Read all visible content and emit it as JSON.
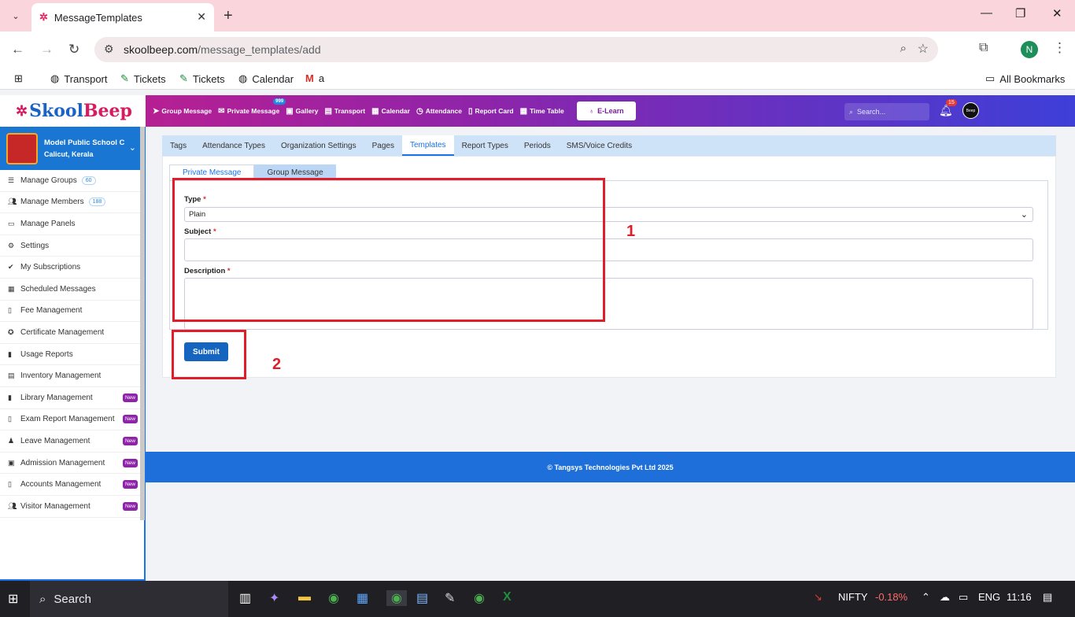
{
  "browser": {
    "tab_title": "MessageTemplates",
    "url_host": "skoolbeep.com",
    "url_path": "/message_templates/add",
    "profile_initial": "N",
    "bookmarks": [
      "Transport",
      "Tickets",
      "Tickets",
      "Calendar",
      "a"
    ],
    "all_bookmarks": "All Bookmarks"
  },
  "app": {
    "logo_prefix": "Skool",
    "logo_suffix": "Beep",
    "nav": [
      {
        "label": "Group Message",
        "icon": "send-icon"
      },
      {
        "label": "Private Message",
        "icon": "envelope-icon",
        "badge": "999"
      },
      {
        "label": "Gallery",
        "icon": "image-icon"
      },
      {
        "label": "Transport",
        "icon": "bus-icon"
      },
      {
        "label": "Calendar",
        "icon": "calendar-icon"
      },
      {
        "label": "Attendance",
        "icon": "clock-icon"
      },
      {
        "label": "Report Card",
        "icon": "file-icon"
      },
      {
        "label": "Time Table",
        "icon": "calendar-icon"
      }
    ],
    "elearn": "E-Learn",
    "search_placeholder": "Search...",
    "notification_count": "15",
    "avatar_text": "Beep"
  },
  "sidebar": {
    "school_name": "Model Public School C",
    "school_location": "Calicut, Kerala",
    "items": [
      {
        "label": "Manage Groups",
        "count": "60"
      },
      {
        "label": "Manage Members",
        "count": "188"
      },
      {
        "label": "Manage Panels"
      },
      {
        "label": "Settings"
      },
      {
        "label": "My Subscriptions"
      },
      {
        "label": "Scheduled Messages"
      },
      {
        "label": "Fee Management"
      },
      {
        "label": "Certificate Management"
      },
      {
        "label": "Usage Reports"
      },
      {
        "label": "Inventory Management"
      },
      {
        "label": "Library Management",
        "new": "New"
      },
      {
        "label": "Exam Report Management",
        "new": "New"
      },
      {
        "label": "Leave Management",
        "new": "New"
      },
      {
        "label": "Admission Management",
        "new": "New"
      },
      {
        "label": "Accounts Management",
        "new": "New"
      },
      {
        "label": "Visitor Management",
        "new": "New"
      }
    ]
  },
  "subtabs": [
    "Tags",
    "Attendance Types",
    "Organization Settings",
    "Pages",
    "Templates",
    "Report Types",
    "Periods",
    "SMS/Voice Credits"
  ],
  "inner_tabs": [
    "Private Message",
    "Group Message"
  ],
  "form": {
    "type_label": "Type",
    "type_value": "Plain",
    "subject_label": "Subject",
    "description_label": "Description",
    "required_mark": "*",
    "submit_label": "Submit"
  },
  "annotations": {
    "box1": "1",
    "box2": "2",
    "color": "#e11d2a"
  },
  "footer": "© Tangsys Technologies Pvt Ltd 2025",
  "taskbar": {
    "search": "Search",
    "ticker_name": "NIFTY",
    "ticker_value": "-0.18%",
    "lang": "ENG",
    "time": "11:16"
  }
}
